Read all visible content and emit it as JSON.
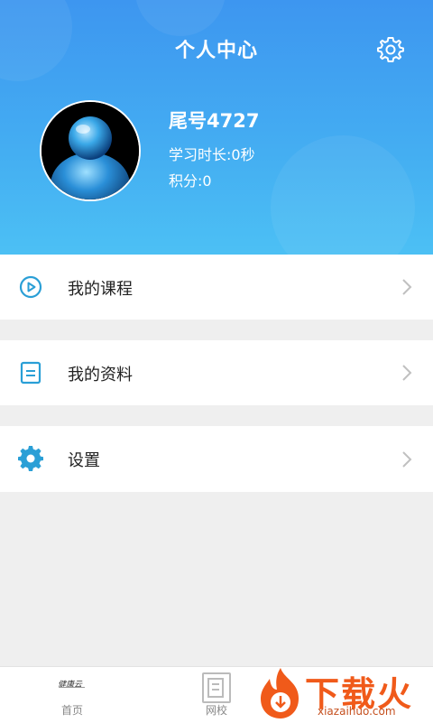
{
  "header": {
    "title": "个人中心",
    "settings_icon": "gear-icon"
  },
  "profile": {
    "name": "尾号4727",
    "study_time": "学习时长:0秒",
    "points": "积分:0"
  },
  "menu": [
    {
      "label": "我的课程",
      "icon": "play-circle-icon"
    },
    {
      "label": "我的资料",
      "icon": "document-icon"
    },
    {
      "label": "设置",
      "icon": "gear-filled-icon"
    }
  ],
  "tabs": [
    {
      "label": "首页",
      "logo": "健康云"
    },
    {
      "label": "网校"
    }
  ],
  "watermark": {
    "text": "下载火",
    "sub": "xiazaihuo.com"
  },
  "colors": {
    "header_start": "#3d96f0",
    "header_end": "#4cc0f4",
    "accent": "#2a9fd6",
    "watermark": "#f05a1a"
  }
}
